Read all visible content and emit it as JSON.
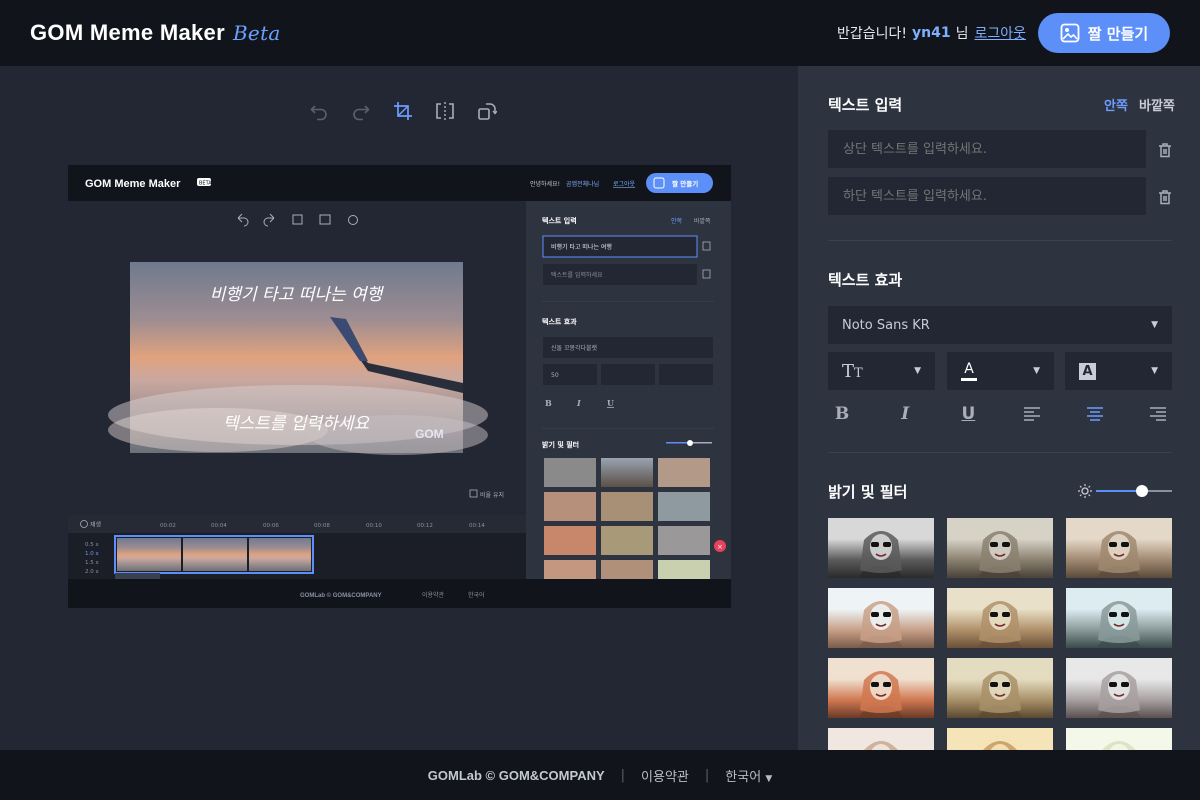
{
  "header": {
    "logo": "GOM Meme Maker",
    "beta": "Beta",
    "greeting": "반갑습니다!",
    "username": "yn41",
    "honorific": "님",
    "logout": "로그아웃",
    "make_button": "짤 만들기"
  },
  "toolbar": {
    "items": [
      "undo-icon",
      "redo-icon",
      "crop-icon",
      "flip-icon",
      "rotate-icon"
    ]
  },
  "preview": {
    "logo": "GOM Meme Maker",
    "badge": "BETA",
    "greeting": "안녕하세요!",
    "username": "곰앱전체나님",
    "logout": "로그아웃",
    "make_button": "짤 만들기",
    "top_caption": "비행기 타고 떠나는 여행",
    "bottom_caption": "텍스트를 입력하세요",
    "watermark": "GOM",
    "keep_ratio": "비율 유지",
    "timeline_label": "재생",
    "ticks": [
      "00:02",
      "00:04",
      "00:06",
      "00:08",
      "00:10",
      "00:12",
      "00:14"
    ],
    "speeds": [
      "0.5 x",
      "1.0 x",
      "1.5 x",
      "2.0 x"
    ],
    "panel": {
      "text_input": "텍스트 입력",
      "inside": "안쪽",
      "outside": "바깥쪽",
      "top_value": "비행기 타고 떠나는 여행",
      "bottom_placeholder": "텍스트를 입력하세요",
      "text_effect": "텍스트 효과",
      "font": "신돌 꼬몽각다블랫",
      "size": "50",
      "filter_title": "밝기 및 필터"
    },
    "footer": {
      "brand": "GOMLab © GOM&COMPANY",
      "terms": "이용약관",
      "lang": "한국어"
    }
  },
  "panel": {
    "text_input_title": "텍스트 입력",
    "tab_inside": "안쪽",
    "tab_outside": "바깥쪽",
    "top_placeholder": "상단 텍스트를 입력하세요.",
    "bottom_placeholder": "하단 텍스트를 입력하세요.",
    "text_effect_title": "텍스트 효과",
    "font_value": "Noto Sans KR",
    "filter_title": "밝기 및 필터",
    "brightness": 0.6,
    "filters": [
      "grayscale",
      "faded",
      "warm",
      "bright",
      "vintage",
      "cool",
      "vivid",
      "sepia",
      "fade",
      "soft",
      "golden",
      "light"
    ]
  },
  "footer": {
    "brand": "GOMLab © GOM&COMPANY",
    "terms": "이용약관",
    "language": "한국어"
  },
  "colors": {
    "accent": "#5d8ff9",
    "header_bg": "#12141b",
    "canvas_bg": "#232733",
    "panel_bg": "#2e3340"
  }
}
